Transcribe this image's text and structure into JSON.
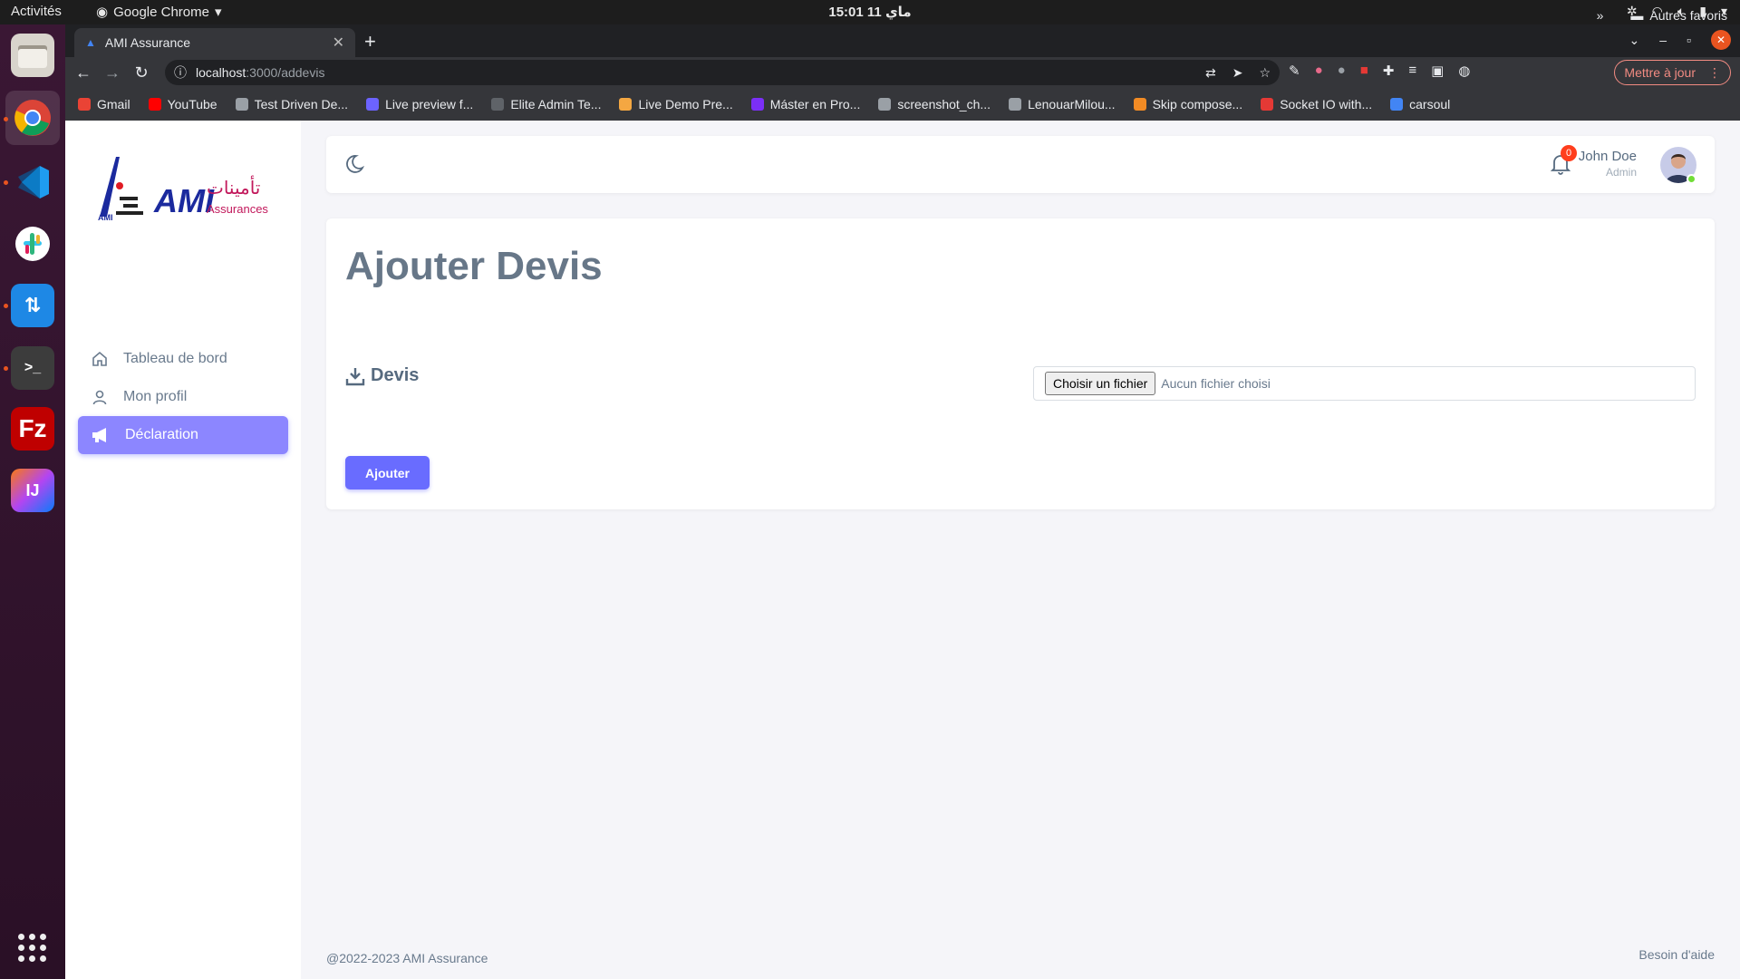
{
  "system": {
    "activities": "Activités",
    "app_name": "Google Chrome",
    "clock": "15:01  11 ماي"
  },
  "browser": {
    "tab_title": "AMI Assurance",
    "url_host": "localhost",
    "url_path": ":3000/addevis",
    "update_label": "Mettre à jour",
    "bookmarks": [
      {
        "label": "Gmail",
        "color": "#ea4335"
      },
      {
        "label": "YouTube",
        "color": "#ff0000"
      },
      {
        "label": "Test Driven De...",
        "color": "#9aa0a6"
      },
      {
        "label": "Live preview f...",
        "color": "#6c63ff"
      },
      {
        "label": "Elite Admin Te...",
        "color": "#5f6368"
      },
      {
        "label": "Live Demo Pre...",
        "color": "#f4a742"
      },
      {
        "label": "Máster en Pro...",
        "color": "#7b2ff7"
      },
      {
        "label": "screenshot_ch...",
        "color": "#9aa0a6"
      },
      {
        "label": "LenouarMilou...",
        "color": "#9aa0a6"
      },
      {
        "label": "Skip compose...",
        "color": "#f28b24"
      },
      {
        "label": "Socket IO with...",
        "color": "#e53935"
      },
      {
        "label": "carsoul",
        "color": "#4285f4"
      }
    ],
    "more_bookmarks": "»",
    "other_bookmarks": "Autres favoris"
  },
  "sidebar": {
    "logo_text": "AMI",
    "logo_sub": "Assurances",
    "logo_arabic": "تأمينات",
    "items": [
      {
        "label": "Tableau de bord"
      },
      {
        "label": "Mon profil"
      },
      {
        "label": "Déclaration"
      }
    ]
  },
  "header": {
    "notification_count": "0",
    "user_name": "John Doe",
    "user_role": "Admin"
  },
  "main": {
    "title": "Ajouter Devis",
    "field_label": "Devis",
    "file_button": "Choisir un fichier",
    "file_status": "Aucun fichier choisi",
    "submit_label": "Ajouter"
  },
  "footer": {
    "copyright": "@2022-2023 AMI Assurance",
    "help": "Besoin d'aide"
  }
}
